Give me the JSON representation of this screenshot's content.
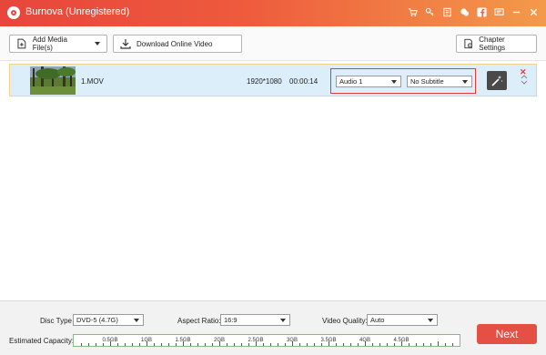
{
  "window": {
    "title": "Burnova (Unregistered)",
    "title_icons": [
      "cart-icon",
      "key-icon",
      "register-icon",
      "chat-icon",
      "facebook-icon",
      "feedback-icon",
      "minimize-icon",
      "close-icon"
    ]
  },
  "toolbar": {
    "add_media_label": "Add Media File(s)",
    "download_label": "Download Online Video",
    "chapter_label": "Chapter Settings"
  },
  "file_row": {
    "name": "1.MOV",
    "resolution": "1920*1080",
    "duration": "00:00:14",
    "audio_track": "Audio 1",
    "subtitle": "No Subtitle"
  },
  "bottom": {
    "disc_type_label": "Disc Type",
    "disc_type_value": "DVD-5 (4.7G)",
    "aspect_ratio_label": "Aspect Ratio:",
    "aspect_ratio_value": "16:9",
    "video_quality_label": "Video Quality:",
    "video_quality_value": "Auto",
    "estimated_capacity_label": "Estimated Capacity:",
    "capacity_ticks": [
      "0.5GB",
      "1GB",
      "1.5GB",
      "2GB",
      "2.5GB",
      "3GB",
      "3.5GB",
      "4GB",
      "4.5GB"
    ],
    "next_label": "Next"
  },
  "colors": {
    "accent": "#e55045",
    "titlebar_start": "#e8453c",
    "titlebar_end": "#f39a4a",
    "selection_box": "#e23b3b",
    "row_bg": "#ddeefb"
  }
}
